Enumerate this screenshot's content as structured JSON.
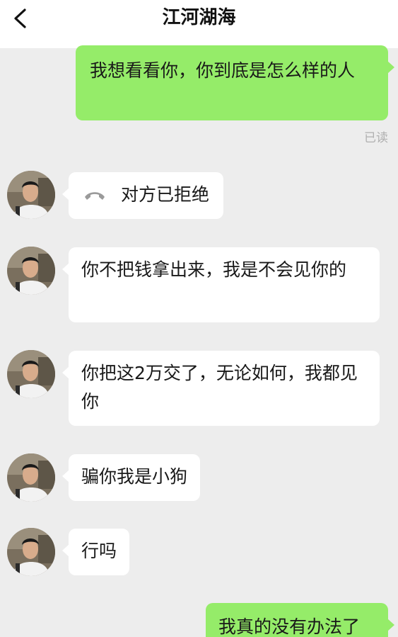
{
  "header": {
    "title": "江河湖海"
  },
  "messages": [
    {
      "id": "m1",
      "side": "out",
      "text": "我想看看你，你到底是怎么样的人"
    },
    {
      "id": "m2",
      "side": "in",
      "type": "call",
      "text": "对方已拒绝"
    },
    {
      "id": "m3",
      "side": "in",
      "text": "你不把钱拿出来，我是不会见你的"
    },
    {
      "id": "m4",
      "side": "in",
      "text": "你把这2万交了，无论如何，我都见你"
    },
    {
      "id": "m5",
      "side": "in",
      "text": "骗你我是小狗"
    },
    {
      "id": "m6",
      "side": "in",
      "text": "行吗"
    },
    {
      "id": "m7",
      "side": "out",
      "text": "我真的没有办法了"
    }
  ],
  "read_receipt": "已读",
  "icons": {
    "back": "chevron-left-icon",
    "call": "phone-hangup-icon"
  },
  "colors": {
    "out_bubble": "#95ec69",
    "in_bubble": "#ffffff",
    "background": "#ededed"
  }
}
